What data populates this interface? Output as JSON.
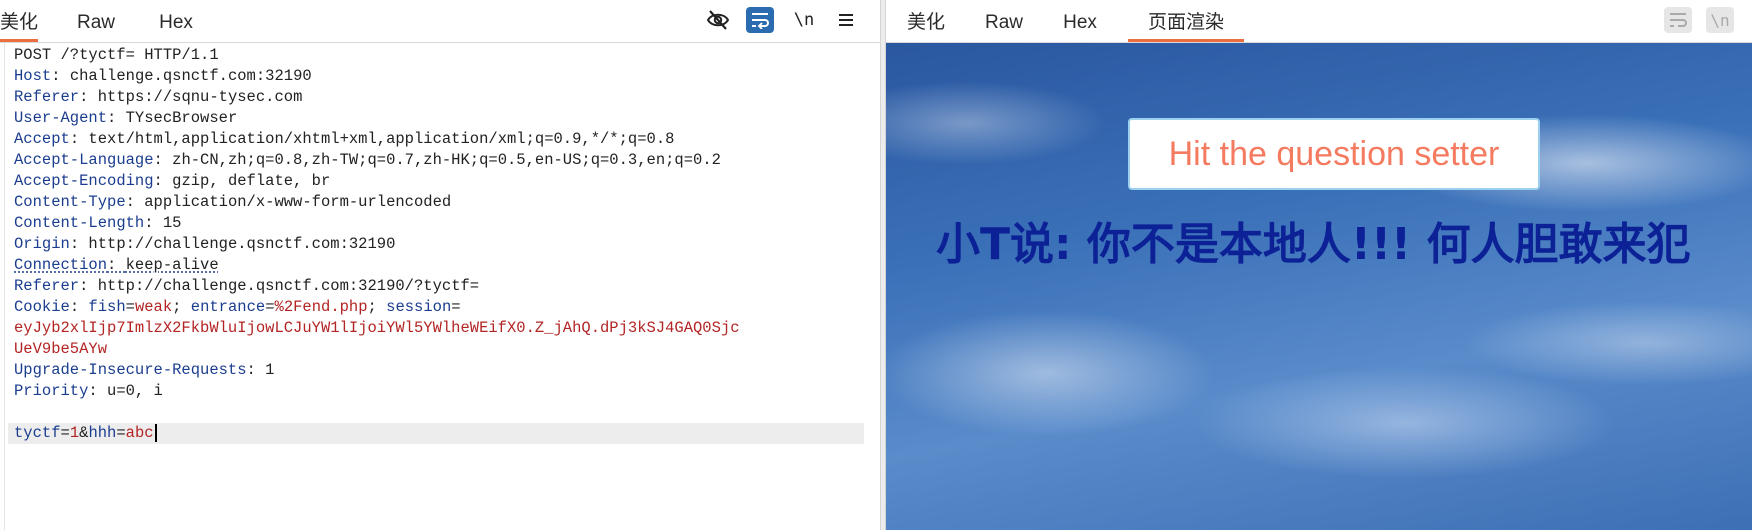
{
  "left_panel": {
    "tabs": [
      {
        "label": "美化",
        "active": true
      },
      {
        "label": "Raw",
        "active": false
      },
      {
        "label": "Hex",
        "active": false
      }
    ],
    "icons": [
      "eye-slash-icon",
      "wrap-text-icon",
      "newline-icon",
      "menu-icon"
    ],
    "newline_label": "\\n",
    "request_line": "POST /?tyctf= HTTP/1.1",
    "headers": [
      {
        "name": "Host",
        "sep": ": ",
        "value": "challenge.qsnctf.com:32190"
      },
      {
        "name": "Referer",
        "sep": ": ",
        "value": "https://sqnu-tysec.com"
      },
      {
        "name": "User-Agent",
        "sep": ": ",
        "value": "TYsecBrowser"
      },
      {
        "name": "Accept",
        "sep": ": ",
        "value": "text/html,application/xhtml+xml,application/xml;q=0.9,*/*;q=0.8"
      },
      {
        "name": "Accept-Language",
        "sep": ": ",
        "value": "zh-CN,zh;q=0.8,zh-TW;q=0.7,zh-HK;q=0.5,en-US;q=0.3,en;q=0.2"
      },
      {
        "name": "Accept-Encoding",
        "sep": ": ",
        "value": "gzip, deflate, br"
      },
      {
        "name": "Content-Type",
        "sep": ": ",
        "value": "application/x-www-form-urlencoded"
      },
      {
        "name": "Content-Length",
        "sep": ": ",
        "value": "15"
      },
      {
        "name": "Origin",
        "sep": ": ",
        "value": "http://challenge.qsnctf.com:32190"
      },
      {
        "name": "Connection",
        "sep": ": ",
        "value": "keep-alive"
      },
      {
        "name": "Referer",
        "sep": ": ",
        "value": "http://challenge.qsnctf.com:32190/?tyctf="
      }
    ],
    "cookie": {
      "name": "Cookie",
      "fish_key": "fish",
      "fish_val": "weak",
      "entrance_key": "entrance",
      "entrance_val": "%2Fend.php",
      "session_key": "session",
      "session_line1": "eyJyb2xlIjp7ImlzX2FkbWluIjowLCJuYW1lIjoiYWl5YWlheWEifX0.Z_jAhQ.dPj3kSJ4GAQ0Sjc",
      "session_line2": "UeV9be5AYw"
    },
    "headers_after": [
      {
        "name": "Upgrade-Insecure-Requests",
        "sep": ": ",
        "value": "1"
      },
      {
        "name": "Priority",
        "sep": ": ",
        "value": "u=0, i"
      }
    ],
    "body": {
      "k1": "tyctf",
      "v1": "1",
      "k2": "hhh",
      "v2": "abc"
    }
  },
  "right_panel": {
    "tabs": [
      {
        "label": "美化",
        "active": false
      },
      {
        "label": "Raw",
        "active": false
      },
      {
        "label": "Hex",
        "active": false
      },
      {
        "label": "页面渲染",
        "active": true
      }
    ],
    "icons": [
      "wrap-text-icon",
      "newline-icon"
    ],
    "newline_label": "\\n",
    "render": {
      "button_label": "Hit the question setter",
      "headline": "小T说: 你不是本地人!!! 何人胆敢来犯"
    }
  },
  "colors": {
    "accent_tab": "#ec6d3f",
    "header_key": "#1b3d8f",
    "cookie_value": "#b32424",
    "headline": "#0c2196",
    "button_text": "#f47a60"
  }
}
